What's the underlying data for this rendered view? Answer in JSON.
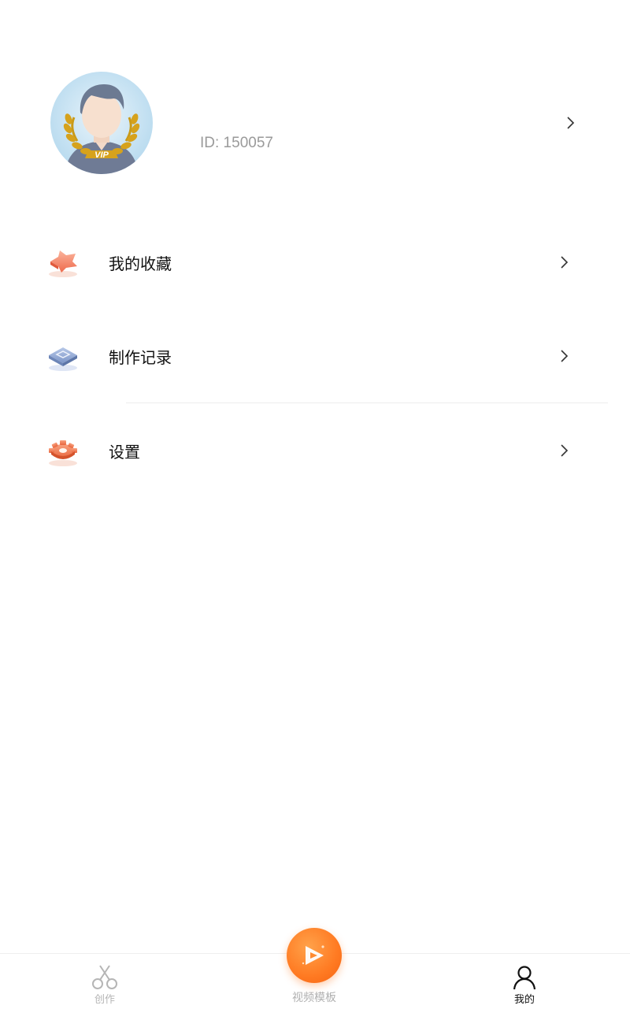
{
  "profile": {
    "avatar_icon": "vip-avatar-icon",
    "avatar_badge": "VIP",
    "user_id": "ID: 150057",
    "chevron_icon": "chevron-right-icon"
  },
  "menu": [
    {
      "label": "我的收藏",
      "icon": "star-icon",
      "accent": "#f0846a"
    },
    {
      "label": "制作记录",
      "icon": "record-icon",
      "accent": "#7d96c8"
    },
    {
      "label": "设置",
      "icon": "gear-icon",
      "accent": "#e8663e"
    }
  ],
  "tabbar": {
    "items": [
      {
        "label": "创作",
        "icon": "scissors-icon",
        "active": false
      },
      {
        "label": "视频模板",
        "icon": "play-button-icon",
        "active": false
      },
      {
        "label": "我的",
        "icon": "person-icon",
        "active": true
      }
    ],
    "accent": "#ff7a22"
  }
}
